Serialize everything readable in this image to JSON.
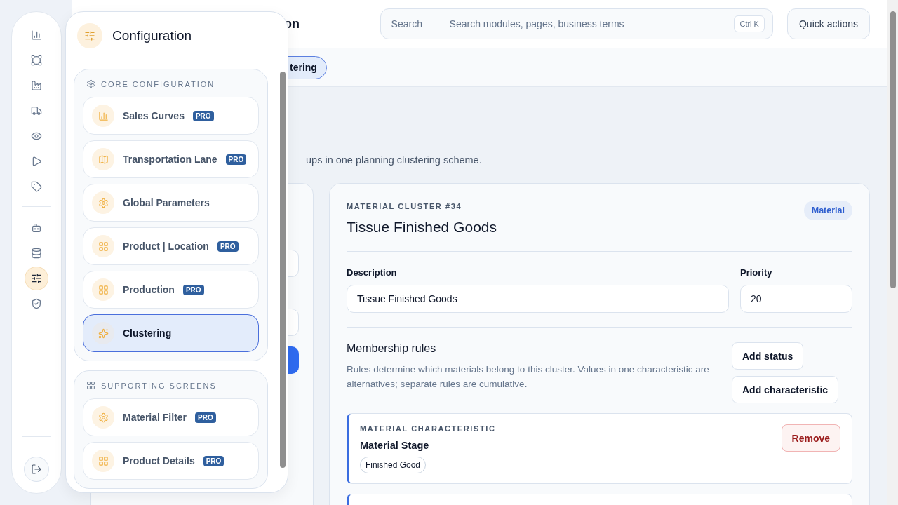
{
  "rail": {
    "groups": [
      {
        "items": [
          {
            "selected": false
          },
          {
            "selected": false
          },
          {
            "selected": false
          },
          {
            "selected": false
          },
          {
            "selected": false
          },
          {
            "selected": false
          },
          {
            "selected": false
          }
        ]
      },
      {
        "items": [
          {
            "selected": false
          },
          {
            "selected": false
          },
          {
            "selected": true
          },
          {
            "selected": false
          }
        ]
      }
    ]
  },
  "header": {
    "title": "on",
    "search": {
      "label": "Search",
      "placeholder": "Search modules, pages, business terms",
      "shortcut": "Ctrl K"
    },
    "quick_actions": "Quick actions"
  },
  "tabs": [
    {
      "label": "tering",
      "selected": true
    }
  ],
  "page": {
    "subtitle": "ups in one planning clustering scheme."
  },
  "cluster": {
    "eyebrow": "MATERIAL CLUSTER #34",
    "title": "Tissue Finished Goods",
    "type_badge": "Material",
    "fields": [
      {
        "label": "Description",
        "value": "Tissue Finished Goods"
      },
      {
        "label": "Priority",
        "value": "20"
      }
    ],
    "rules": {
      "title": "Membership rules",
      "description": "Rules determine which materials belong to this cluster. Values in one characteristic are alternatives; separate rules are cumulative.",
      "buttons": [
        "Add status",
        "Add characteristic"
      ],
      "items": [
        {
          "kind": "characteristic",
          "eyebrow": "MATERIAL CHARACTERISTIC",
          "name": "Material Stage",
          "values": [
            "Finished Good"
          ],
          "action": "Remove"
        },
        {
          "kind": "cut_off"
        }
      ]
    }
  },
  "flyout": {
    "title": "Configuration",
    "sections": [
      {
        "title": "CORE CONFIGURATION",
        "items": [
          {
            "label": "Sales Curves",
            "badge": "PRO",
            "selected": false
          },
          {
            "label": "Transportation Lane",
            "badge": "PRO",
            "selected": false
          },
          {
            "label": "Global Parameters",
            "selected": false
          },
          {
            "label": "Product | Location",
            "badge": "PRO",
            "selected": false
          },
          {
            "label": "Production",
            "badge": "PRO",
            "selected": false
          },
          {
            "label": "Clustering",
            "selected": true
          }
        ]
      },
      {
        "title": "SUPPORTING SCREENS",
        "items": [
          {
            "label": "Material Filter",
            "badge": "PRO",
            "selected": false
          },
          {
            "label": "Product Details",
            "badge": "PRO",
            "selected": false
          }
        ]
      }
    ]
  }
}
